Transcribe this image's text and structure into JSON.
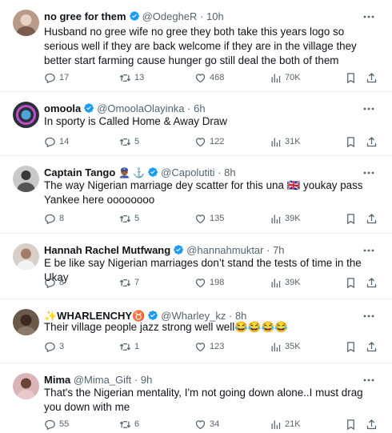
{
  "tweets": [
    {
      "name": "no gree for them",
      "handle": "@OdegheR",
      "time": "· 10h",
      "emoji": "",
      "text": "Husband no gree wife no gree they both take this years logo so serious well if they are back welcome if they are in the village they better start farming cause hunger go still deal the both of them",
      "replies": "17",
      "reposts": "13",
      "likes": "468",
      "views": "70K",
      "avatar_color": "#b89a8a"
    },
    {
      "name": "omoola",
      "handle": "@OmoolaOlayinka",
      "time": "· 6h",
      "emoji": "",
      "text": "In sporty is Called Home  &  Away Draw",
      "replies": "14",
      "reposts": "5",
      "likes": "122",
      "views": "31K",
      "avatar_color": "#2a2f3a"
    },
    {
      "name": "Captain Tango",
      "handle": "@Capolutiti",
      "time": "· 8h",
      "emoji": "👮🏾‍♂️ ⚓",
      "text": "The way Nigerian marriage dey scatter for this una 🇬🇧 youkay pass Yankee here oooooooo",
      "replies": "8",
      "reposts": "5",
      "likes": "135",
      "views": "39K",
      "avatar_color": "#c9c9c9"
    },
    {
      "name": "Hannah Rachel Mutfwang",
      "handle": "@hannahmuktar",
      "time": "· 7h",
      "emoji": "",
      "text": "E be like say Nigerian marriages don’t stand the tests of time in the  Ukay",
      "replies": "8",
      "reposts": "7",
      "likes": "198",
      "views": "39K",
      "avatar_color": "#d8cfc8"
    },
    {
      "name": "✨WHARLENCHY♉",
      "handle": "@Wharley_kz",
      "time": "· 8h",
      "emoji": "",
      "text": "Their village people jazz strong well well😂😂😂😂",
      "replies": "3",
      "reposts": "1",
      "likes": "123",
      "views": "35K",
      "avatar_color": "#6b5a4a"
    },
    {
      "name": "Mima",
      "handle": "@Mima_Gift",
      "time": "· 9h",
      "emoji": "",
      "text": "That's the Nigerian mentality, I'm not going down alone..I must drag you down with me",
      "replies": "55",
      "reposts": "6",
      "likes": "34",
      "views": "21K",
      "avatar_color": "#d9b4b8"
    }
  ],
  "colors": {
    "verified": "#1d9bf0",
    "icon": "#536471",
    "divider": "#eff3f4"
  },
  "icons": [
    "reply-icon",
    "repost-icon",
    "like-icon",
    "views-icon",
    "bookmark-icon",
    "share-icon",
    "more-icon",
    "verified-badge-icon"
  ]
}
